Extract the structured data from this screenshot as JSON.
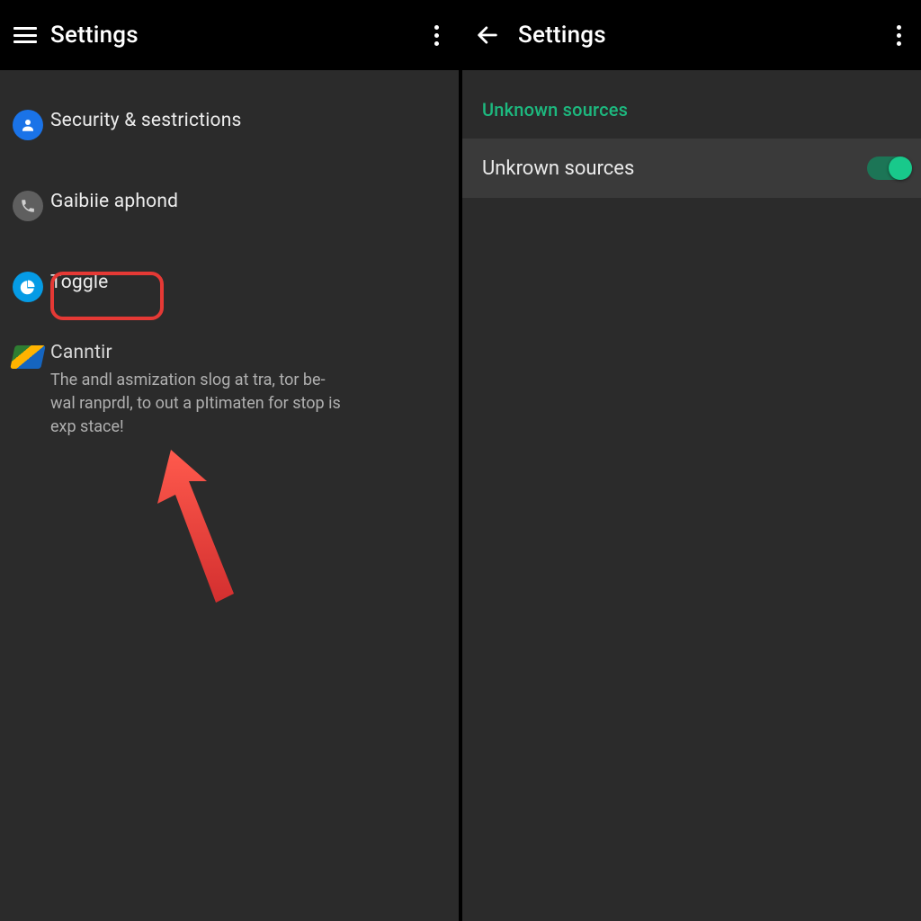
{
  "left": {
    "appbar": {
      "title": "Settings"
    },
    "items": [
      {
        "label": "Security & sestrictions"
      },
      {
        "label": "Gaibiie aphond"
      },
      {
        "label": "Toggle"
      },
      {
        "label": "Canntir",
        "desc": "The andl asmization slog at tra, tor be-wal ranprdl, to out a pItimaten for stop is exp stace!"
      }
    ]
  },
  "right": {
    "appbar": {
      "title": "Settings"
    },
    "section_header": "Unknown sources",
    "toggle": {
      "label": "Unkrown sources",
      "on": true
    }
  },
  "colors": {
    "accent_green": "#1db97f",
    "switch_thumb": "#18c98b",
    "annotation_red": "#e53935"
  }
}
